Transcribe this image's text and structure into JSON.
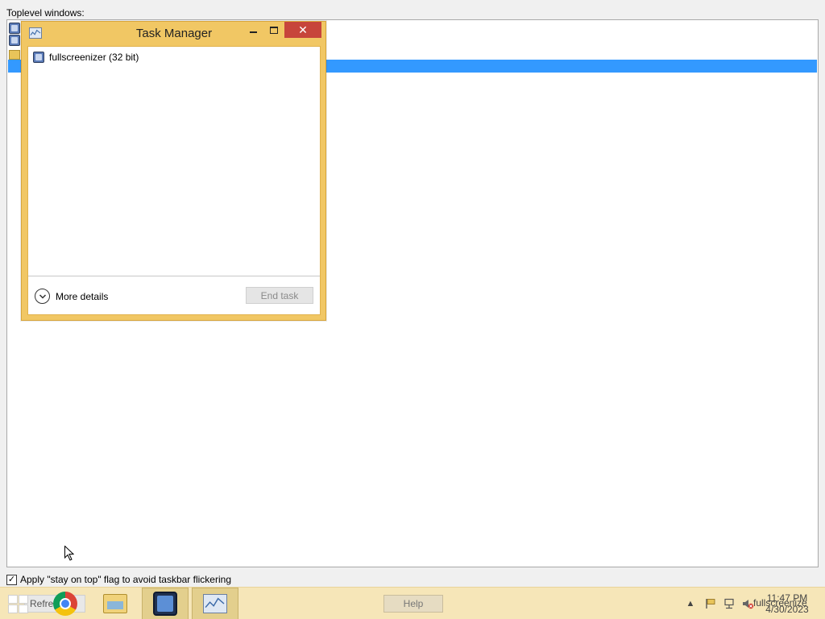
{
  "app": {
    "list_label": "Toplevel windows:",
    "stay_on_top_checked": true,
    "stay_on_top_label": "Apply \"stay on top\" flag to avoid taskbar flickering"
  },
  "task_manager": {
    "title": "Task Manager",
    "close_glyph": "✕",
    "process": "fullscreenizer (32 bit)",
    "more_details": "More details",
    "end_task": "End task"
  },
  "taskbar": {
    "refresh_label": "Refre",
    "help_label": "Help",
    "tray_overlay_label": "fullscreenize",
    "time": "11:47 PM",
    "date": "4/30/2023",
    "up_arrow": "▲"
  },
  "colors": {
    "selection": "#3399ff",
    "tm_frame": "#f1c764",
    "tm_close": "#c7453b",
    "taskbar": "#f6e6b8"
  },
  "icons": [
    "app-icon",
    "folder-icon",
    "task-manager-icon",
    "chevron-down-icon",
    "windows-start-icon",
    "chrome-icon",
    "file-explorer-icon",
    "fullscreenizer-icon",
    "flag-icon",
    "network-icon",
    "volume-muted-icon"
  ]
}
